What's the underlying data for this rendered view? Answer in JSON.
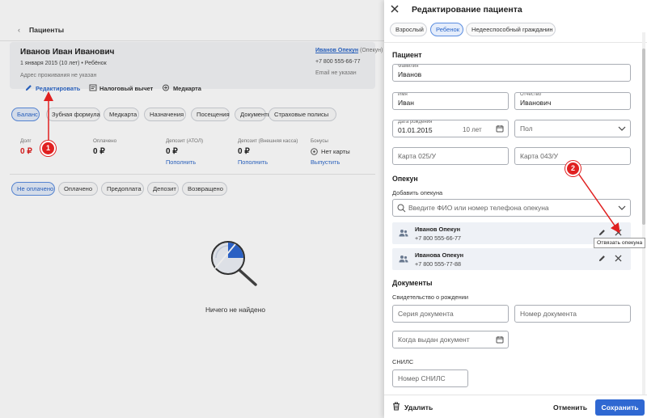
{
  "page": {
    "back_label": "Пациенты",
    "patient": {
      "name": "Иванов Иван Иванович",
      "birth": "1 января 2015 (10 лет) • Ребёнок",
      "address": "Адрес проживания не указан",
      "guardian_link": "Иванов Опекун",
      "guardian_role": "(Опекун)",
      "phone": "+7 800 555-66-77",
      "email": "Email не указан"
    },
    "actions": {
      "edit": "Редактировать",
      "tax": "Налоговый вычет",
      "medcard": "Медкарта"
    },
    "tabs": [
      "Баланс",
      "Зубная формула",
      "Медкарта",
      "Назначения",
      "Посещения",
      "Документы",
      "Страховые полисы"
    ],
    "balance": {
      "debt_label": "Долг",
      "debt_value": "0 ₽",
      "paid_label": "Оплачено",
      "paid_value": "0 ₽",
      "deposit_label": "Депозит (АТОЛ)",
      "deposit_value": "0 ₽",
      "deposit_action": "Пополнить",
      "deposit_ext_label": "Депозит (Внешняя касса)",
      "deposit_ext_value": "0 ₽",
      "deposit_ext_action": "Пополнить",
      "bonus_label": "Бонусы",
      "bonus_value": "Нет карты",
      "bonus_action": "Выпустить"
    },
    "filters": [
      "Не оплачено",
      "Оплачено",
      "Предоплата",
      "Депозит",
      "Возвращено"
    ],
    "empty_text": "Ничего не найдено"
  },
  "panel": {
    "title": "Редактирование пациента",
    "types": [
      "Взрослый",
      "Ребенок",
      "Недееспособный гражданин"
    ],
    "patient_section": "Пациент",
    "lastname_label": "Фамилия",
    "lastname": "Иванов",
    "firstname_label": "Имя",
    "firstname": "Иван",
    "middlename_label": "Отчество",
    "middlename": "Иванович",
    "birth_label": "Дата рождения",
    "birth": "01.01.2015",
    "age": "10 лет",
    "gender_placeholder": "Пол",
    "card025_placeholder": "Карта 025/У",
    "card043_placeholder": "Карта 043/У",
    "guardian_section": "Опекун",
    "add_guardian_label": "Добавить опекуна",
    "guardian_search_placeholder": "Введите ФИО или номер телефона опекуна",
    "guardians": [
      {
        "name": "Иванов Опекун",
        "phone": "+7 800 555-66-77"
      },
      {
        "name": "Иванова Опекун",
        "phone": "+7 800 555-77-88"
      }
    ],
    "tooltip": "Отвязать опекуна",
    "docs_section": "Документы",
    "birth_cert_label": "Свидетельство о рождении",
    "doc_series_placeholder": "Серия документа",
    "doc_number_placeholder": "Номер документа",
    "doc_issued_placeholder": "Когда выдан документ",
    "snils_label": "СНИЛС",
    "snils_placeholder": "Номер СНИЛС",
    "delete_label": "Удалить",
    "cancel_label": "Отменить",
    "save_label": "Сохранить"
  },
  "annotations": {
    "step1": "1",
    "step2": "2"
  },
  "colors": {
    "accent": "#2c67c9",
    "danger": "#e02020",
    "save_bg": "#2f68d2"
  }
}
